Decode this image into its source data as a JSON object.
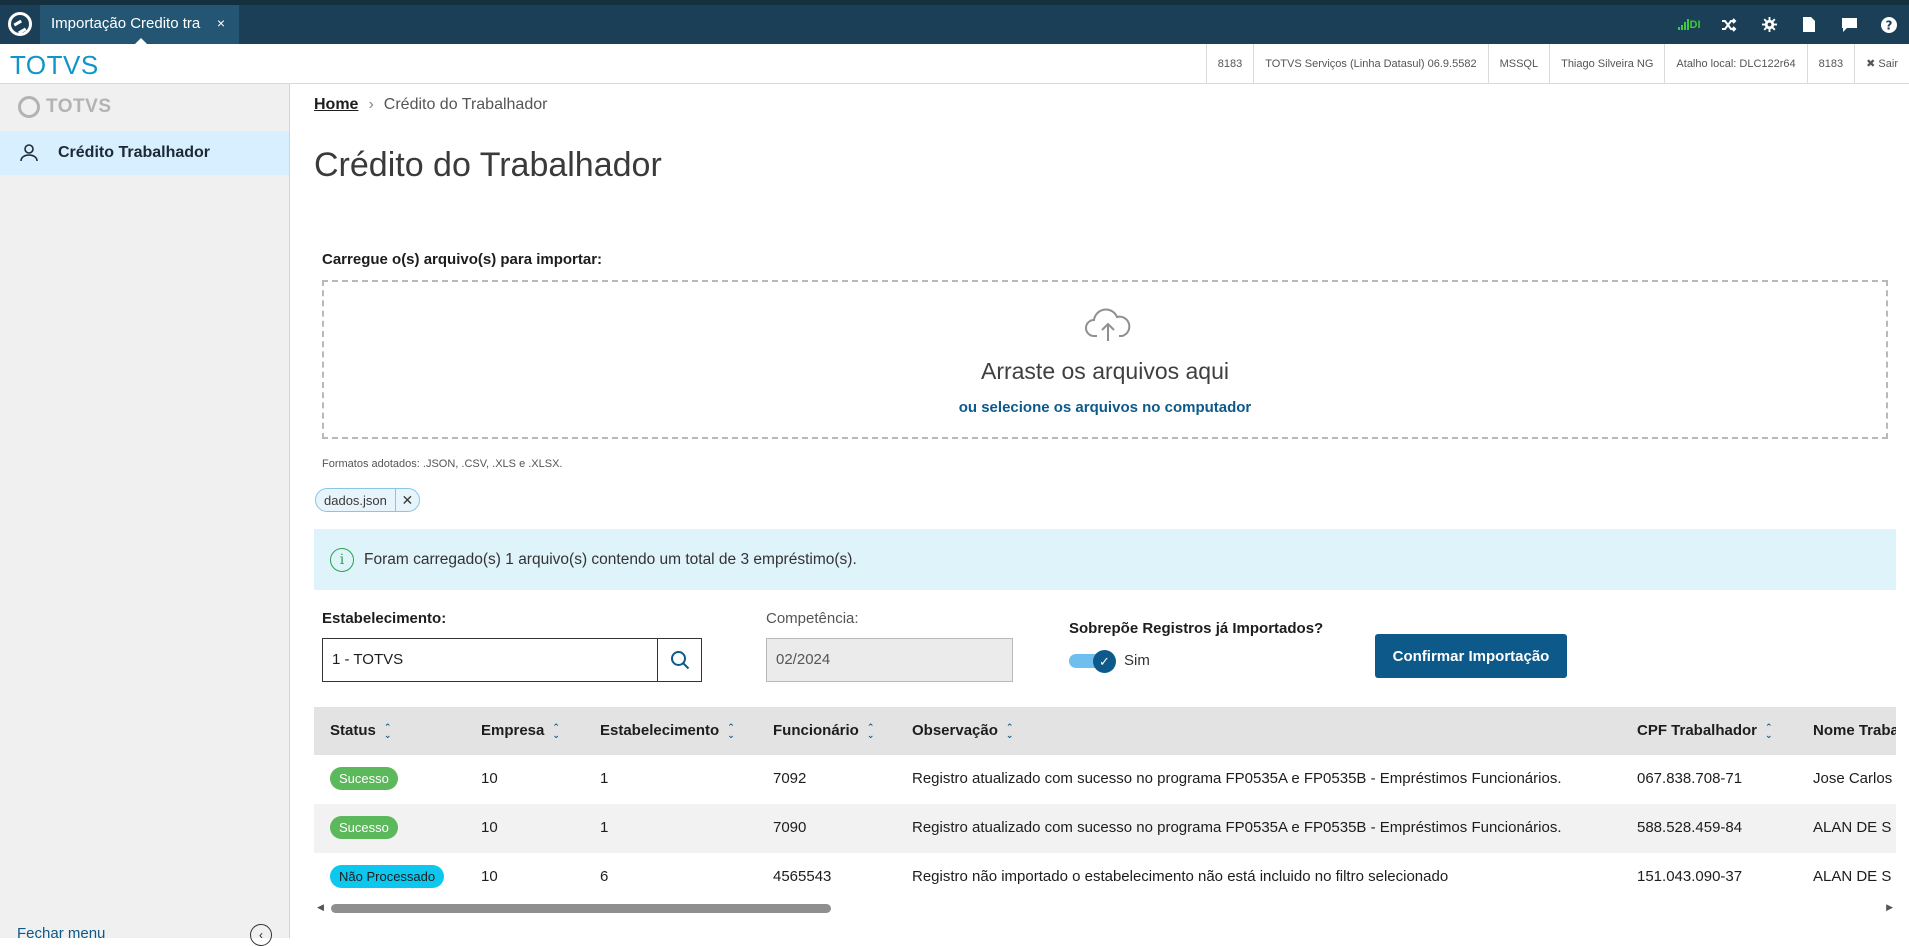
{
  "topbar": {
    "tab_title": "Importação Credito tra",
    "tab_close": "×",
    "signal_label": "DI"
  },
  "header": {
    "brand": "TOTVS",
    "info": [
      "8183",
      "TOTVS Serviços (Linha Datasul) 06.9.5582",
      "MSSQL",
      "Thiago Silveira NG",
      "Atalho local: DLC122r64",
      "8183",
      "✖ Sair"
    ]
  },
  "sidebar": {
    "logo_text": "TOTVS",
    "items": [
      {
        "label": "Crédito Trabalhador"
      }
    ],
    "footer": "Fechar menu"
  },
  "breadcrumb": {
    "home": "Home",
    "separator": "›",
    "current": "Crédito do Trabalhador"
  },
  "page_title": "Crédito do Trabalhador",
  "upload": {
    "label": "Carregue o(s) arquivo(s) para importar:",
    "drop_text": "Arraste os arquivos aqui",
    "select_link": "ou selecione os arquivos no computador",
    "formats": "Formatos adotados: .JSON, .CSV, .XLS e .XLSX.",
    "file_chip": "dados.json"
  },
  "alert": {
    "message": "Foram carregado(s) 1 arquivo(s) contendo um total de 3 empréstimo(s)."
  },
  "form": {
    "estabelecimento_label": "Estabelecimento:",
    "estabelecimento_value": "1 - TOTVS",
    "competencia_label": "Competência:",
    "competencia_value": "02/2024",
    "sobrepoe_label": "Sobrepõe Registros já Importados?",
    "toggle_value": "Sim",
    "toggle_on": true,
    "confirm_button": "Confirmar Importação"
  },
  "table": {
    "columns": [
      "Status",
      "Empresa",
      "Estabelecimento",
      "Funcionário",
      "Observação",
      "CPF Trabalhador",
      "Nome Traba"
    ],
    "rows": [
      {
        "status": "Sucesso",
        "empresa": "10",
        "estabelecimento": "1",
        "funcionario": "7092",
        "observacao": "Registro atualizado com sucesso no programa FP0535A e FP0535B - Empréstimos Funcionários.",
        "cpf": "067.838.708-71",
        "nome": "Jose Carlos"
      },
      {
        "status": "Sucesso",
        "empresa": "10",
        "estabelecimento": "1",
        "funcionario": "7090",
        "observacao": "Registro atualizado com sucesso no programa FP0535A e FP0535B - Empréstimos Funcionários.",
        "cpf": "588.528.459-84",
        "nome": "ALAN DE S"
      },
      {
        "status": "Não Processado",
        "empresa": "10",
        "estabelecimento": "6",
        "funcionario": "4565543",
        "observacao": "Registro não importado o estabelecimento não está incluido no filtro selecionado",
        "cpf": "151.043.090-37",
        "nome": "ALAN DE S"
      }
    ]
  },
  "colors": {
    "primary": "#0d5a8a",
    "topbar": "#1b3f56",
    "success": "#5bb85b",
    "pending": "#0dc7ee",
    "alert_bg": "#dff3fb"
  }
}
